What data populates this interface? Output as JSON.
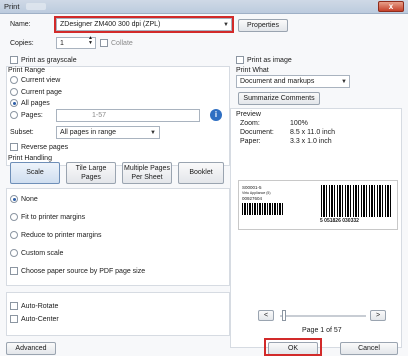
{
  "window": {
    "title": "Print",
    "close_label": "x"
  },
  "printer": {
    "name_label": "Name:",
    "name_value": "ZDesigner ZM400 300 dpi (ZPL)",
    "properties_label": "Properties",
    "copies_label": "Copies:",
    "copies_value": "1",
    "collate_label": "Collate",
    "grayscale_label": "Print as grayscale",
    "print_as_image_label": "Print as image"
  },
  "print_range": {
    "header": "Print Range",
    "current_view": "Current view",
    "current_page": "Current page",
    "all_pages": "All pages",
    "pages_label": "Pages:",
    "pages_value": "1-57",
    "subset_label": "Subset:",
    "subset_value": "All pages in range",
    "reverse_label": "Reverse pages"
  },
  "print_what": {
    "header": "Print What",
    "value": "Document and markups",
    "summarize_label": "Summarize Comments"
  },
  "preview": {
    "header": "Preview",
    "zoom_label": "Zoom:",
    "zoom_value": "100%",
    "document_label": "Document:",
    "document_value": "8.5 x 11.0 inch",
    "paper_label": "Paper:",
    "paper_value": "3.3 x 1.0 inch",
    "label_line1": "S00001-5",
    "label_line2": "Virtu Appliance (5)",
    "label_line3": "00927604",
    "barcode_text": "5  051826  030332",
    "page_text": "Page 1 of 57",
    "prev_label": "<",
    "next_label": ">"
  },
  "handling": {
    "header": "Print Handling",
    "tabs": [
      "Scale",
      "Tile Large Pages",
      "Multiple Pages Per Sheet",
      "Booklet"
    ],
    "none": "None",
    "fit": "Fit to printer margins",
    "reduce": "Reduce to printer margins",
    "custom": "Custom scale",
    "paper_source": "Choose paper source by PDF page size",
    "auto_rotate": "Auto-Rotate",
    "auto_center": "Auto-Center"
  },
  "footer": {
    "advanced_label": "Advanced",
    "ok_label": "OK",
    "cancel_label": "Cancel"
  },
  "colors": {
    "highlight": "#d22a2a",
    "accent": "#2d5ea8"
  }
}
